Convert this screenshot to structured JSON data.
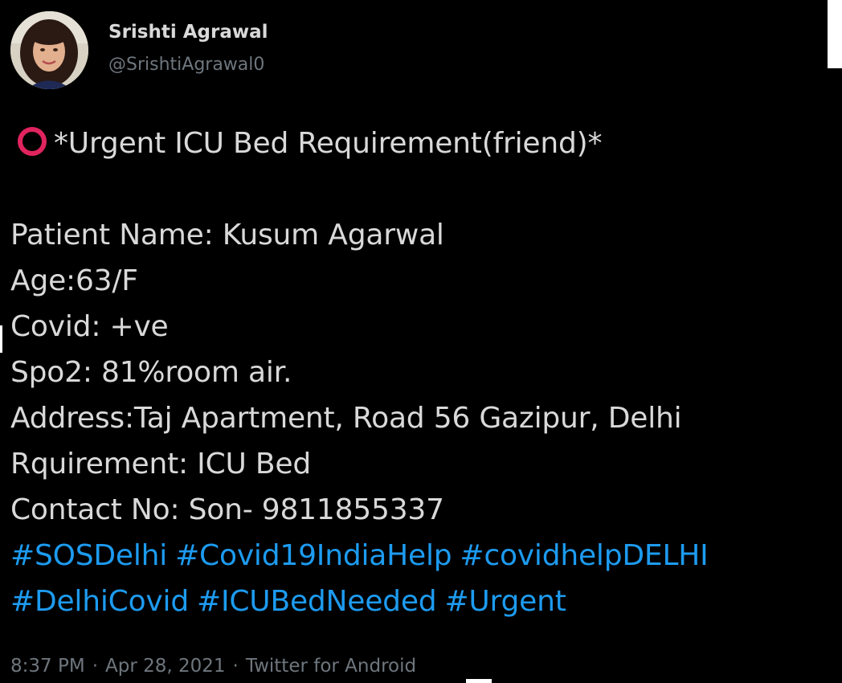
{
  "author": {
    "name": "Srishti Agrawal",
    "handle": "@SrishtiAgrawal0",
    "avatar": "profile-photo"
  },
  "tweet": {
    "title_icon": "red-circle-icon",
    "title_text": "*Urgent ICU Bed Requirement(friend)*",
    "lines": [
      "Patient Name: Kusum Agarwal",
      "Age:63/F",
      "Covid: +ve",
      "Spo2: 81%room air.",
      "Address:Taj Apartment, Road 56 Gazipur, Delhi",
      "Rquirement: ICU Bed",
      "Contact No: Son- 9811855337"
    ],
    "hashtags_line1": [
      "#SOSDelhi",
      "#Covid19IndiaHelp",
      "#covidhelpDELHI"
    ],
    "hashtags_line2": [
      "#DelhiCovid",
      "#ICUBedNeeded",
      "#Urgent"
    ]
  },
  "meta": {
    "time": "8:37 PM",
    "date": "Apr 28, 2021",
    "source": "Twitter for Android",
    "separator": "·"
  },
  "colors": {
    "background": "#000000",
    "text": "#d9d9d9",
    "muted": "#6e767d",
    "hashtag": "#1d9bf0",
    "alert_circle": "#e0245e"
  }
}
